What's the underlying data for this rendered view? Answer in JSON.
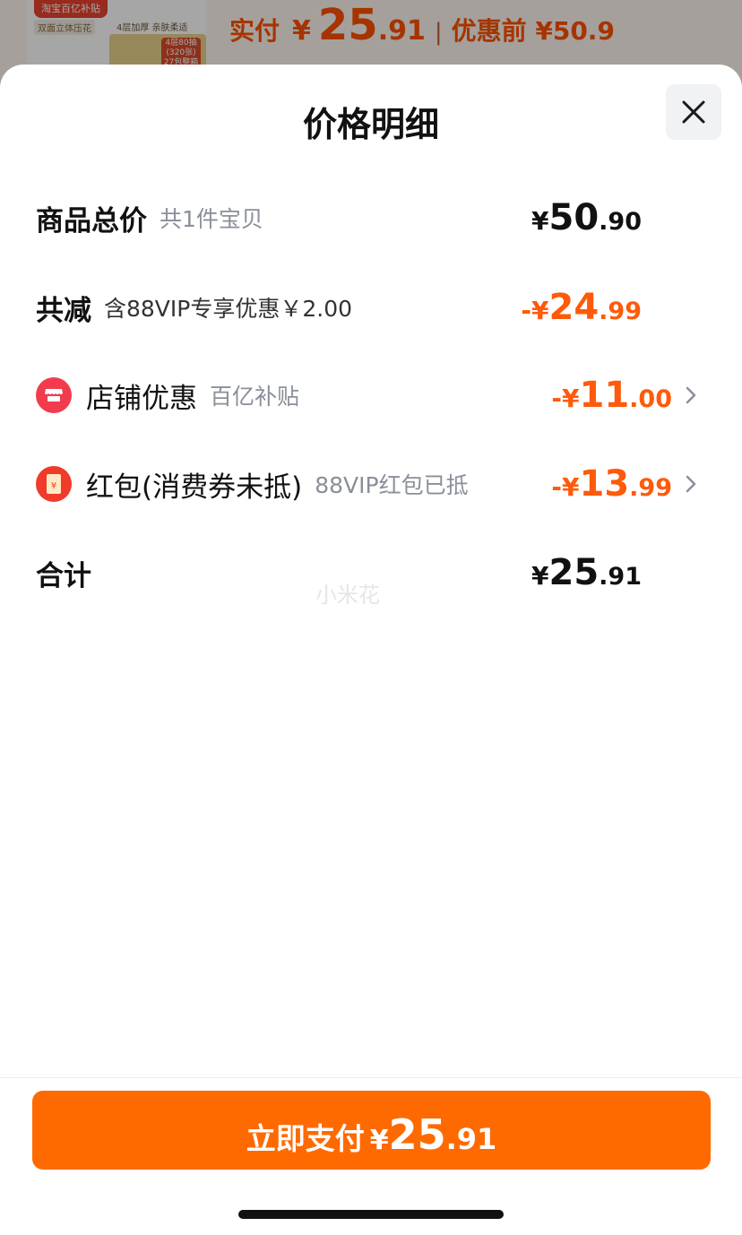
{
  "background": {
    "thumb_badge": "淘宝百亿补贴",
    "thumb_tag1": "双面立体压花",
    "thumb_tag2": "4层加厚 亲肤柔适",
    "thumb_box_label": "4层80抽 (320张) 27包整箱",
    "price_label": "实付",
    "currency": "¥",
    "price_int": "25",
    "price_dec": ".91",
    "separator": "|",
    "orig_label": "优惠前 ¥50.9"
  },
  "sheet": {
    "title": "价格明细",
    "close_icon": "close-icon"
  },
  "rows": {
    "subtotal": {
      "label": "商品总价",
      "sub": "共1件宝贝",
      "currency": "¥",
      "int": "50",
      "dec": ".90"
    },
    "discount_total": {
      "label": "共减",
      "sub": "含88VIP专享优惠￥2.00",
      "currency": "-¥",
      "int": "24",
      "dec": ".99"
    },
    "store_discount": {
      "icon": "store-icon",
      "label": "店铺优惠",
      "sub": "百亿补贴",
      "currency": "-¥",
      "int": "11",
      "dec": ".00"
    },
    "red_packet": {
      "icon": "red-packet-icon",
      "label": "红包(消费券未抵)",
      "sub": "88VIP红包已抵",
      "currency": "-¥",
      "int": "13",
      "dec": ".99"
    },
    "total": {
      "label": "合计",
      "currency": "¥",
      "int": "25",
      "dec": ".91"
    }
  },
  "watermark": "小米花",
  "pay_button": {
    "label": "立即支付",
    "currency": "¥",
    "int": "25",
    "dec": ".91"
  },
  "colors": {
    "accent": "#ff6a00",
    "discount_text": "#ff5a0a",
    "store_icon_bg": "#f23c4e",
    "red_packet_icon_bg": "#f03a2a"
  }
}
